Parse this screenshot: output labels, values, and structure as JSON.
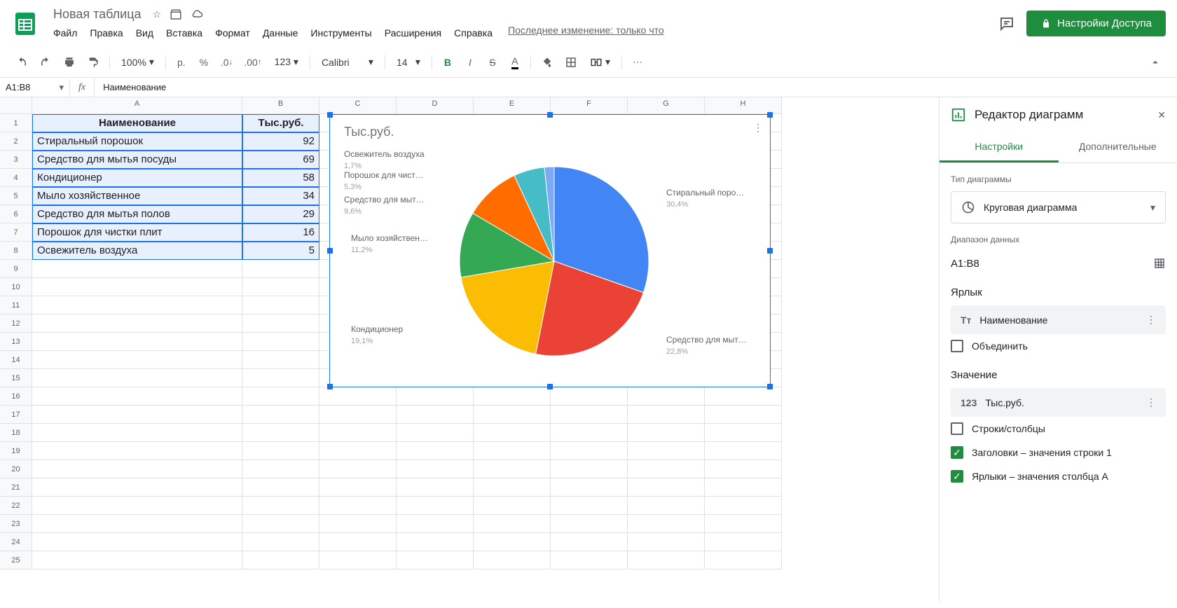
{
  "header": {
    "doc_title": "Новая таблица",
    "menus": [
      "Файл",
      "Правка",
      "Вид",
      "Вставка",
      "Формат",
      "Данные",
      "Инструменты",
      "Расширения",
      "Справка"
    ],
    "last_modified": "Последнее изменение: только что",
    "share_label": "Настройки Доступа"
  },
  "toolbar": {
    "zoom": "100%",
    "currency": "р.",
    "font": "Calibri",
    "font_size": "14"
  },
  "formula_bar": {
    "cell_ref": "A1:B8",
    "value": "Наименование"
  },
  "columns": [
    "A",
    "B",
    "C",
    "D",
    "E",
    "F",
    "G",
    "H"
  ],
  "rows_count": 25,
  "table": {
    "headers": [
      "Наименование",
      "Тыс.руб."
    ],
    "rows": [
      [
        "Стиральный порошок",
        92
      ],
      [
        "Средство для мытья посуды",
        69
      ],
      [
        "Кондиционер",
        58
      ],
      [
        "Мыло хозяйственное",
        34
      ],
      [
        "Средство для мытья полов",
        29
      ],
      [
        "Порошок для чистки плит",
        16
      ],
      [
        "Освежитель воздуха",
        5
      ]
    ]
  },
  "chart_data": {
    "type": "pie",
    "title": "Тыс.руб.",
    "categories": [
      "Стиральный порошок",
      "Средство для мытья посуды",
      "Кондиционер",
      "Мыло хозяйственное",
      "Средство для мытья полов",
      "Порошок для чистки плит",
      "Освежитель воздуха"
    ],
    "values": [
      92,
      69,
      58,
      34,
      29,
      16,
      5
    ],
    "percent_labels": [
      "30,4%",
      "22,8%",
      "19,1%",
      "11,2%",
      "9,6%",
      "5,3%",
      "1,7%"
    ],
    "display_labels": [
      "Стиральный поро…",
      "Средство для мыт…",
      "Кондиционер",
      "Мыло хозяйствен…",
      "Средство для мыт…",
      "Порошок для чист…",
      "Освежитель воздуха"
    ],
    "colors": [
      "#4285f4",
      "#ea4335",
      "#fbbc04",
      "#34a853",
      "#ff6d01",
      "#46bdc6",
      "#7baaf7"
    ]
  },
  "sidebar": {
    "title": "Редактор диаграмм",
    "tabs": [
      "Настройки",
      "Дополнительные"
    ],
    "type_label": "Тип диаграммы",
    "type_value": "Круговая диаграмма",
    "range_label": "Диапазон данных",
    "range_value": "A1:B8",
    "yarlyk_label": "Ярлык",
    "yarlyk_value": "Наименование",
    "combine_label": "Объединить",
    "value_label": "Значение",
    "value_chip": "Тыс.руб.",
    "rows_cols_label": "Строки/столбцы",
    "headers_row_label": "Заголовки – значения строки 1",
    "labels_col_label": "Ярлыки – значения столбца A"
  }
}
